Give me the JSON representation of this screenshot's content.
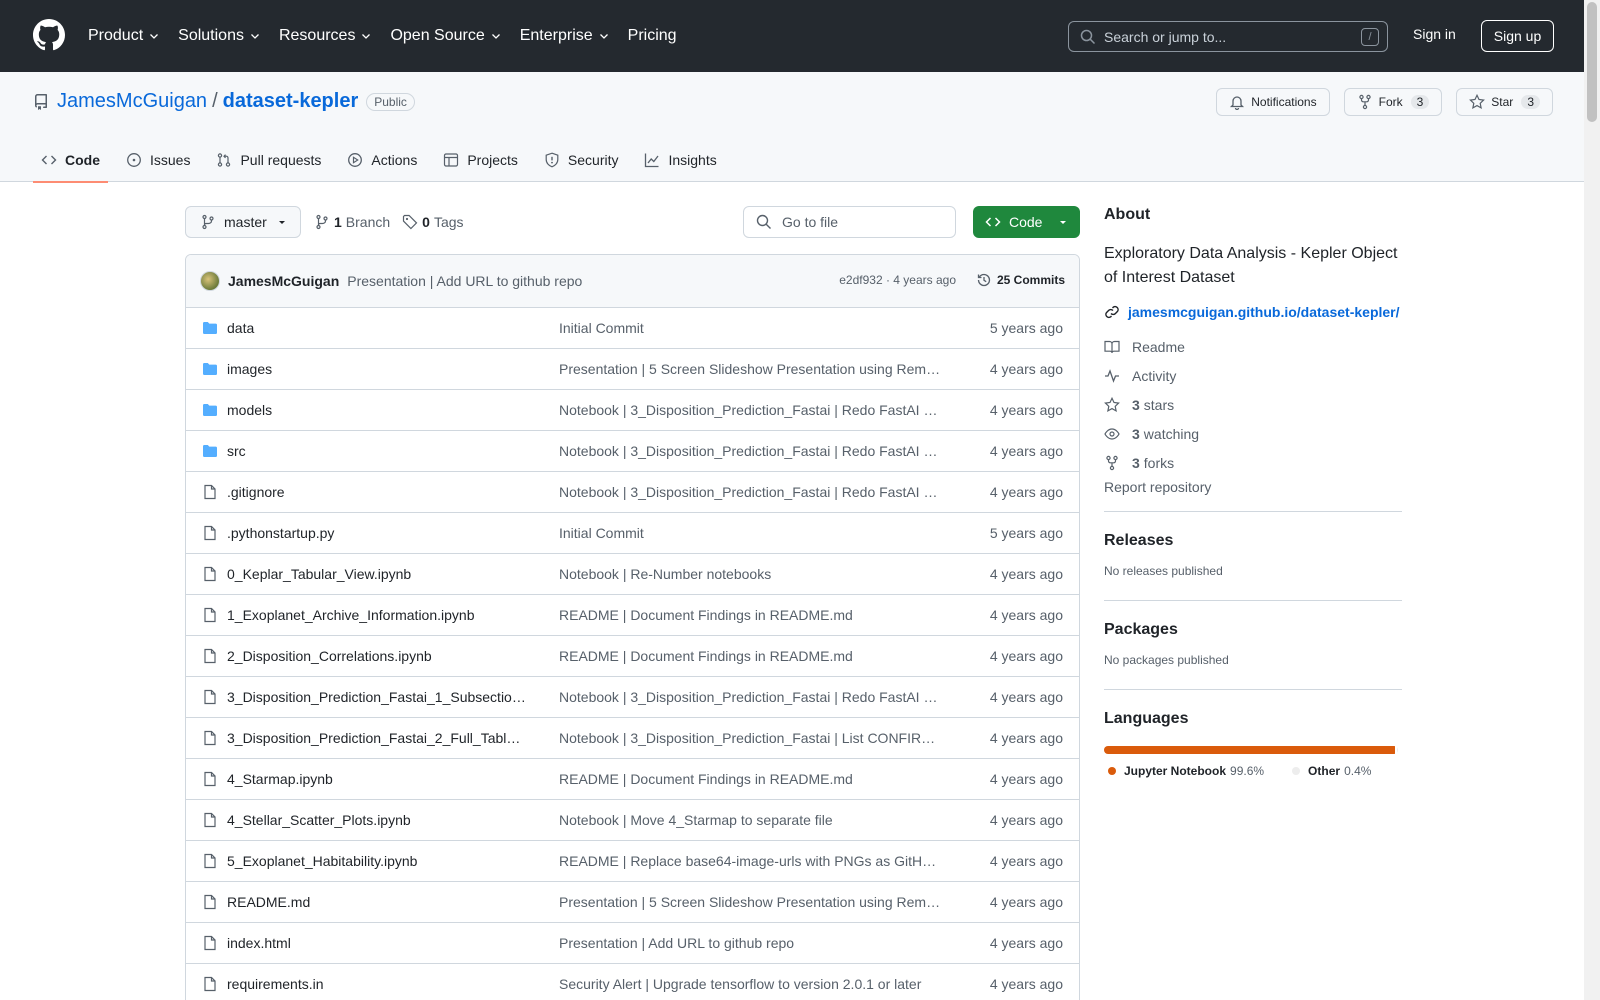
{
  "header": {
    "nav": [
      {
        "label": "Product",
        "dropdown": true
      },
      {
        "label": "Solutions",
        "dropdown": true
      },
      {
        "label": "Resources",
        "dropdown": true
      },
      {
        "label": "Open Source",
        "dropdown": true
      },
      {
        "label": "Enterprise",
        "dropdown": true
      },
      {
        "label": "Pricing",
        "dropdown": false
      }
    ],
    "search_placeholder": "Search or jump to...",
    "search_shortcut": "/",
    "sign_in": "Sign in",
    "sign_up": "Sign up"
  },
  "repo": {
    "owner": "JamesMcGuigan",
    "separator": "/",
    "name": "dataset-kepler",
    "visibility": "Public",
    "notifications_label": "Notifications",
    "fork_label": "Fork",
    "fork_count": "3",
    "star_label": "Star",
    "star_count": "3"
  },
  "tabs": [
    {
      "label": "Code",
      "icon": "code-icon",
      "active": true
    },
    {
      "label": "Issues",
      "icon": "issue-icon",
      "active": false
    },
    {
      "label": "Pull requests",
      "icon": "pull-request-icon",
      "active": false
    },
    {
      "label": "Actions",
      "icon": "play-icon",
      "active": false
    },
    {
      "label": "Projects",
      "icon": "table-icon",
      "active": false
    },
    {
      "label": "Security",
      "icon": "shield-icon",
      "active": false
    },
    {
      "label": "Insights",
      "icon": "graph-icon",
      "active": false
    }
  ],
  "branch_bar": {
    "branch": "master",
    "branch_count": "1",
    "branch_label": "Branch",
    "tag_count": "0",
    "tag_label": "Tags",
    "go_to_file": "Go to file",
    "code_button": "Code"
  },
  "latest_commit": {
    "author": "JamesMcGuigan",
    "message": "Presentation | Add URL to github repo",
    "meta": "e2df932 · 4 years ago",
    "commits": "25 Commits"
  },
  "files": [
    {
      "type": "dir",
      "name": "data",
      "message": "Initial Commit",
      "age": "5 years ago"
    },
    {
      "type": "dir",
      "name": "images",
      "message": "Presentation | 5 Screen Slideshow Presentation using Rem…",
      "age": "4 years ago"
    },
    {
      "type": "dir",
      "name": "models",
      "message": "Notebook | 3_Disposition_Prediction_Fastai | Redo FastAI …",
      "age": "4 years ago"
    },
    {
      "type": "dir",
      "name": "src",
      "message": "Notebook | 3_Disposition_Prediction_Fastai | Redo FastAI …",
      "age": "4 years ago"
    },
    {
      "type": "file",
      "name": ".gitignore",
      "message": "Notebook | 3_Disposition_Prediction_Fastai | Redo FastAI …",
      "age": "4 years ago"
    },
    {
      "type": "file",
      "name": ".pythonstartup.py",
      "message": "Initial Commit",
      "age": "5 years ago"
    },
    {
      "type": "file",
      "name": "0_Keplar_Tabular_View.ipynb",
      "message": "Notebook | Re-Number notebooks",
      "age": "4 years ago"
    },
    {
      "type": "file",
      "name": "1_Exoplanet_Archive_Information.ipynb",
      "message": "README | Document Findings in README.md",
      "age": "4 years ago"
    },
    {
      "type": "file",
      "name": "2_Disposition_Correlations.ipynb",
      "message": "README | Document Findings in README.md",
      "age": "4 years ago"
    },
    {
      "type": "file",
      "name": "3_Disposition_Prediction_Fastai_1_Subsectio…",
      "message": "Notebook | 3_Disposition_Prediction_Fastai | Redo FastAI …",
      "age": "4 years ago"
    },
    {
      "type": "file",
      "name": "3_Disposition_Prediction_Fastai_2_Full_Tabl…",
      "message": "Notebook | 3_Disposition_Prediction_Fastai | List CONFIR…",
      "age": "4 years ago"
    },
    {
      "type": "file",
      "name": "4_Starmap.ipynb",
      "message": "README | Document Findings in README.md",
      "age": "4 years ago"
    },
    {
      "type": "file",
      "name": "4_Stellar_Scatter_Plots.ipynb",
      "message": "Notebook | Move 4_Starmap to separate file",
      "age": "4 years ago"
    },
    {
      "type": "file",
      "name": "5_Exoplanet_Habitability.ipynb",
      "message": "README | Replace base64-image-urls with PNGs as GitH…",
      "age": "4 years ago"
    },
    {
      "type": "file",
      "name": "README.md",
      "message": "Presentation | 5 Screen Slideshow Presentation using Rem…",
      "age": "4 years ago"
    },
    {
      "type": "file",
      "name": "index.html",
      "message": "Presentation | Add URL to github repo",
      "age": "4 years ago"
    },
    {
      "type": "file",
      "name": "requirements.in",
      "message": "Security Alert | Upgrade tensorflow to version 2.0.1 or later",
      "age": "4 years ago"
    }
  ],
  "about": {
    "title": "About",
    "description": "Exploratory Data Analysis - Kepler Object of Interest Dataset",
    "link": "jamesmcguigan.github.io/dataset-kepler/",
    "readme": "Readme",
    "activity": "Activity",
    "stars_count": "3",
    "stars_label": "stars",
    "watching_count": "3",
    "watching_label": "watching",
    "forks_count": "3",
    "forks_label": "forks",
    "report": "Report repository"
  },
  "releases": {
    "title": "Releases",
    "empty": "No releases published"
  },
  "packages": {
    "title": "Packages",
    "empty": "No packages published"
  },
  "languages": {
    "title": "Languages",
    "items": [
      {
        "name": "Jupyter Notebook",
        "percent": "99.6%",
        "value": 99.6,
        "color": "#DA5B0B"
      },
      {
        "name": "Other",
        "percent": "0.4%",
        "value": 0.4,
        "color": "#ededed"
      }
    ]
  }
}
